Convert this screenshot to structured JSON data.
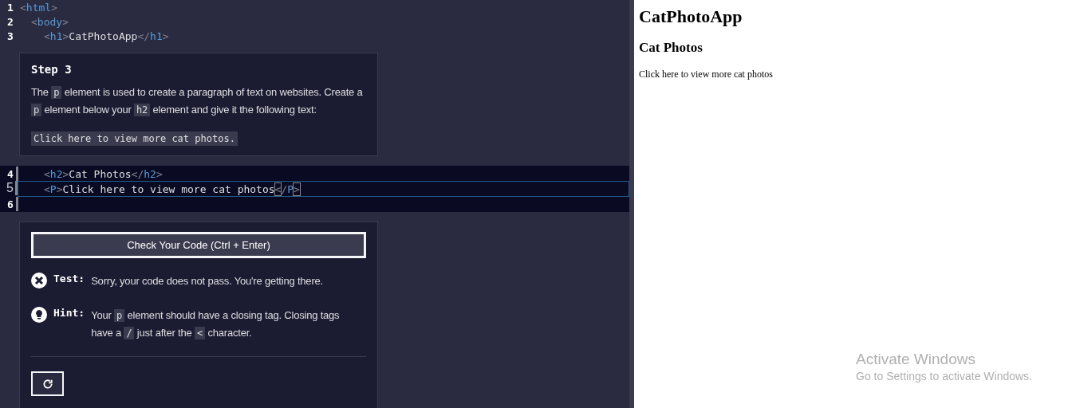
{
  "code_top": [
    {
      "number": "1",
      "active": true,
      "tokens": [
        {
          "kind": "bracket",
          "text": "<"
        },
        {
          "kind": "tag",
          "text": "html"
        },
        {
          "kind": "bracket",
          "text": ">"
        }
      ]
    },
    {
      "number": "2",
      "active": true,
      "kind": "child",
      "tokens": [
        {
          "kind": "bracket",
          "text": "<"
        },
        {
          "kind": "tag",
          "text": "body"
        },
        {
          "kind": "bracket",
          "text": ">"
        }
      ]
    },
    {
      "number": "3",
      "active": true,
      "kind": "grandchild",
      "tokens": [
        {
          "kind": "bracket",
          "text": "<"
        },
        {
          "kind": "tag",
          "text": "h1"
        },
        {
          "kind": "bracket",
          "text": ">"
        },
        {
          "kind": "text",
          "text": "CatPhotoApp"
        },
        {
          "kind": "bracket",
          "text": "</"
        },
        {
          "kind": "tag",
          "text": "h1"
        },
        {
          "kind": "bracket",
          "text": ">"
        }
      ]
    }
  ],
  "step": {
    "title": "Step 3",
    "paragraph": [
      {
        "kind": "text",
        "text": "The "
      },
      {
        "kind": "code",
        "text": "p"
      },
      {
        "kind": "text",
        "text": " element is used to create a paragraph of text on websites. Create a "
      },
      {
        "kind": "code",
        "text": "p"
      },
      {
        "kind": "text",
        "text": " element below your "
      },
      {
        "kind": "code",
        "text": "h2"
      },
      {
        "kind": "text",
        "text": " element and give it the following text:"
      }
    ],
    "example": "Click here to view more cat photos."
  },
  "code_edit": [
    {
      "number": "4",
      "active": true,
      "cursor": false,
      "kind": "grandchild",
      "tokens": [
        {
          "kind": "bracket",
          "text": "<"
        },
        {
          "kind": "tag",
          "text": "h2"
        },
        {
          "kind": "bracket",
          "text": ">"
        },
        {
          "kind": "text",
          "text": "Cat Photos"
        },
        {
          "kind": "bracket",
          "text": "</"
        },
        {
          "kind": "tag",
          "text": "h2"
        },
        {
          "kind": "bracket",
          "text": ">"
        }
      ]
    },
    {
      "number": "5",
      "active": false,
      "cursor": true,
      "kind": "grandchild",
      "tokens": [
        {
          "kind": "bracket",
          "text": "<"
        },
        {
          "kind": "tag",
          "text": "P"
        },
        {
          "kind": "bracket",
          "text": ">"
        },
        {
          "kind": "text",
          "text": "Click here to view more cat photos"
        },
        {
          "kind": "match",
          "text": "<"
        },
        {
          "kind": "bracket",
          "text": "/"
        },
        {
          "kind": "tag",
          "text": "P"
        },
        {
          "kind": "match",
          "text": ">"
        }
      ]
    },
    {
      "number": "6",
      "active": true,
      "cursor": false
    }
  ],
  "check_button": "Check Your Code (Ctrl + Enter)",
  "test": {
    "label": "Test:",
    "text": "Sorry, your code does not pass. You're getting there."
  },
  "hint": {
    "label": "Hint:",
    "text": [
      {
        "kind": "text",
        "text": "Your "
      },
      {
        "kind": "code",
        "text": "p"
      },
      {
        "kind": "text",
        "text": " element should have a closing tag. Closing tags have a "
      },
      {
        "kind": "code",
        "text": "/"
      },
      {
        "kind": "text",
        "text": " just after the "
      },
      {
        "kind": "code",
        "text": "<"
      },
      {
        "kind": "text",
        "text": " character."
      }
    ]
  },
  "preview": {
    "h1": "CatPhotoApp",
    "h2": "Cat Photos",
    "p": "Click here to view more cat photos"
  },
  "os_notice": {
    "title": "Activate Windows",
    "text": "Go to Settings to activate Windows."
  }
}
